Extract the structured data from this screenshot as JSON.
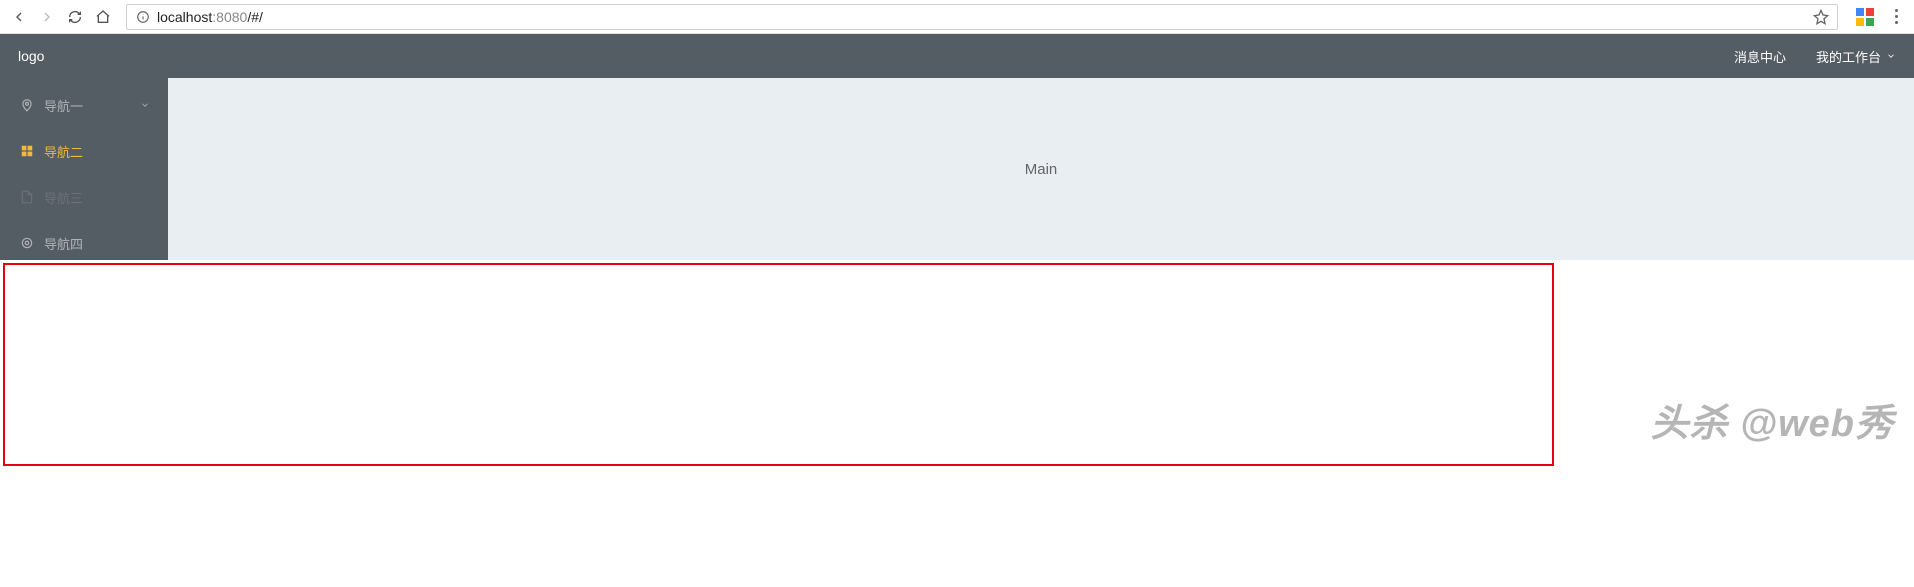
{
  "browser": {
    "url_host": "localhost",
    "url_port": ":8080",
    "url_path": "/#/"
  },
  "header": {
    "logo": "logo",
    "message_center": "消息中心",
    "workspace": "我的工作台"
  },
  "sidebar": {
    "items": [
      {
        "label": "导航一",
        "icon": "location-icon",
        "expandable": true
      },
      {
        "label": "导航二",
        "icon": "grid-icon",
        "active": true
      },
      {
        "label": "导航三",
        "icon": "document-icon",
        "dim": true
      },
      {
        "label": "导航四",
        "icon": "target-icon"
      }
    ]
  },
  "main": {
    "content": "Main"
  },
  "watermark": "头杀 @web秀"
}
